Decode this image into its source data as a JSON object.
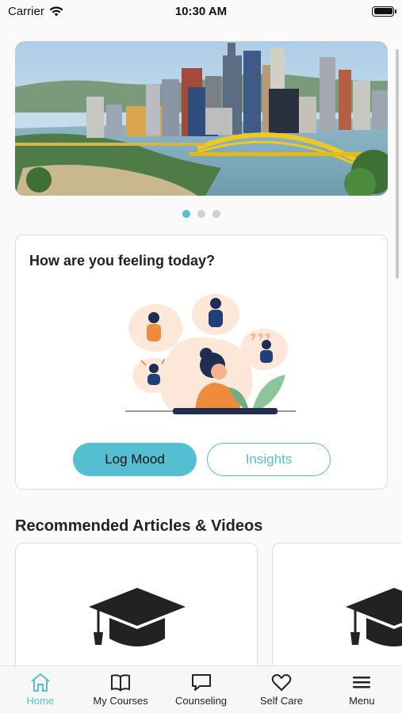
{
  "status_bar": {
    "carrier": "Carrier",
    "time": "10:30 AM"
  },
  "carousel": {
    "slide_count": 3,
    "active_index": 0
  },
  "mood_card": {
    "title": "How are you feeling today?",
    "log_mood_label": "Log Mood",
    "insights_label": "Insights"
  },
  "recommended": {
    "title": "Recommended Articles & Videos"
  },
  "tab_bar": {
    "items": [
      {
        "label": "Home",
        "icon": "home-icon",
        "active": true
      },
      {
        "label": "My Courses",
        "icon": "book-icon",
        "active": false
      },
      {
        "label": "Counseling",
        "icon": "chat-bubble-icon",
        "active": false
      },
      {
        "label": "Self Care",
        "icon": "heart-icon",
        "active": false
      },
      {
        "label": "Menu",
        "icon": "hamburger-menu-icon",
        "active": false
      }
    ]
  },
  "colors": {
    "accent": "#53bfd0",
    "text": "#222222",
    "background": "#fafafa"
  }
}
